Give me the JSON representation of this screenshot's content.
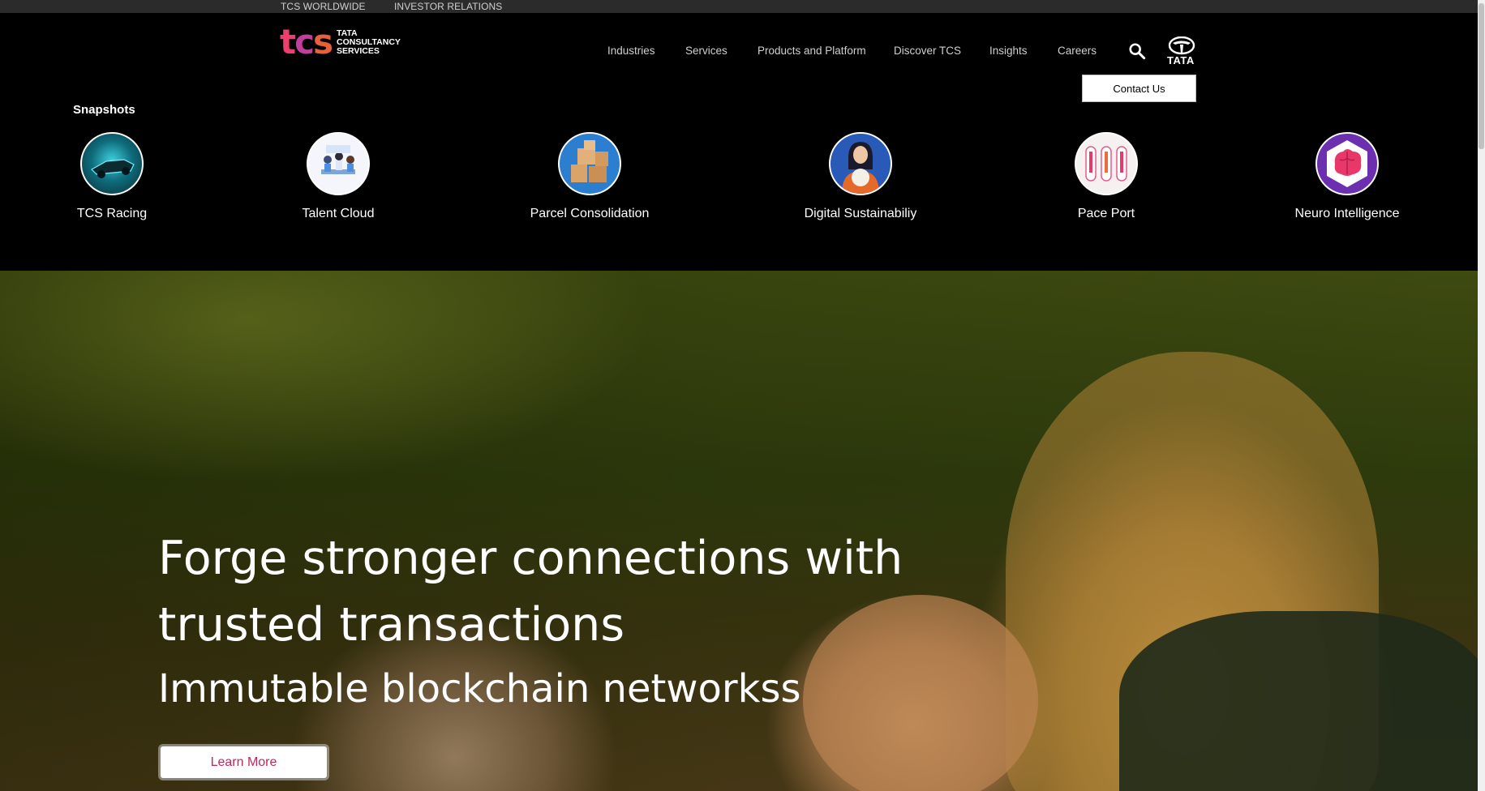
{
  "utility": {
    "worldwide": "TCS WORLDWIDE",
    "investor": "INVESTOR RELATIONS"
  },
  "logo": {
    "mark": "tcs",
    "line1": "TATA",
    "line2": "CONSULTANCY",
    "line3": "SERVICES"
  },
  "nav": {
    "items": [
      "Industries",
      "Services",
      "Products and Platform",
      "Discover TCS",
      "Insights",
      "Careers"
    ],
    "search_icon": "search-icon",
    "brand": "TATA"
  },
  "contact": {
    "label": "Contact Us"
  },
  "snapshots": {
    "title": "Snapshots",
    "items": [
      {
        "label": "TCS Racing",
        "icon": "racing-car-icon"
      },
      {
        "label": "Talent Cloud",
        "icon": "team-meeting-icon"
      },
      {
        "label": "Parcel Consolidation",
        "icon": "parcels-icon"
      },
      {
        "label": "Digital Sustainabiliy",
        "icon": "crystal-ball-icon"
      },
      {
        "label": "Pace Port",
        "icon": "pace-port-icon"
      },
      {
        "label": "Neuro Intelligence",
        "icon": "brain-icon"
      }
    ]
  },
  "hero": {
    "title": "Forge stronger connections with trusted transactions",
    "subtitle": "Immutable blockchain networkss",
    "cta": "Learn More"
  },
  "colors": {
    "accent": "#c0265b",
    "background": "#000000"
  }
}
